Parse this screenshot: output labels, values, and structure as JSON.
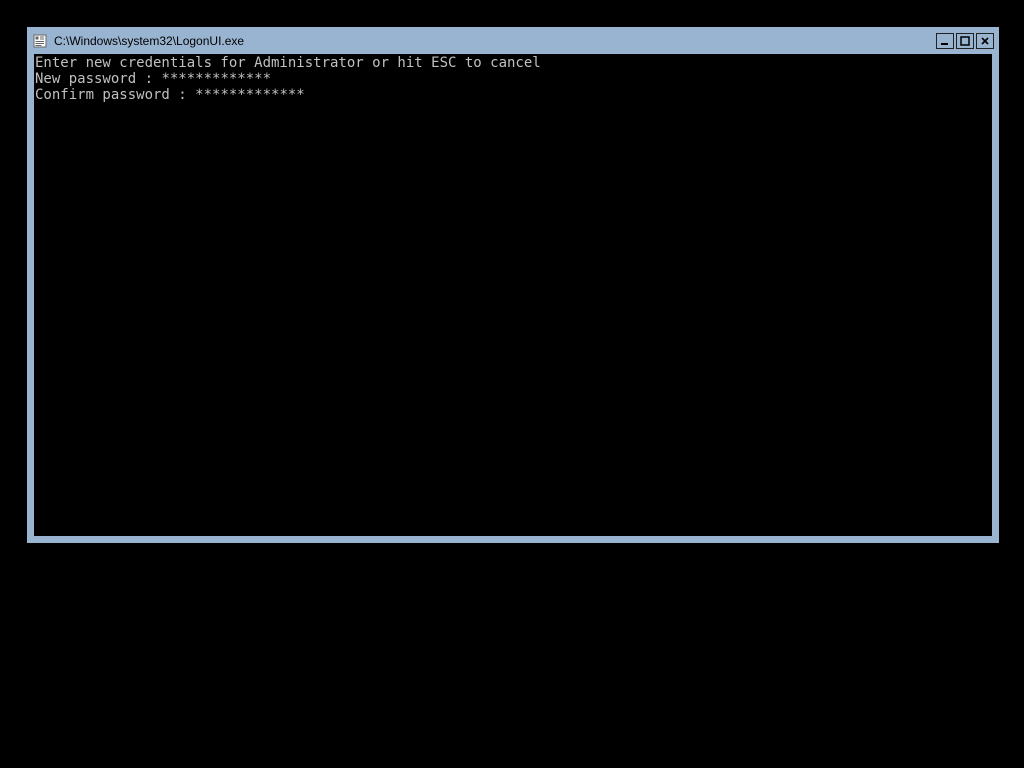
{
  "window": {
    "title": "C:\\Windows\\system32\\LogonUI.exe"
  },
  "console": {
    "line1": "Enter new credentials for Administrator or hit ESC to cancel",
    "line2_prefix": "New password : ",
    "line2_mask": "*************",
    "line3_prefix": "Confirm password : ",
    "line3_mask": "*************"
  }
}
